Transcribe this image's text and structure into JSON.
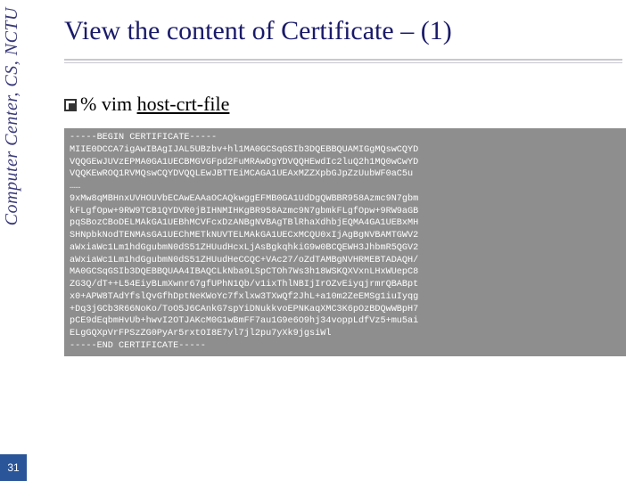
{
  "sidebar": {
    "org": "Computer Center, CS, NCTU"
  },
  "page": {
    "number": "31",
    "title": "View the content of Certificate – (1)"
  },
  "command": {
    "prefix": "% vim ",
    "filename": "host-crt-file"
  },
  "certificate": {
    "text": "-----BEGIN CERTIFICATE-----\nMIIE0DCCA7igAwIBAgIJAL5UBzbv+hl1MA0GCSqGSIb3DQEBBQUAMIGgMQswCQYD\nVQQGEwJUVzEPMA0GA1UECBMGVGFpd2FuMRAwDgYDVQQHEwdIc2luQ2h1MQ0wCwYD\nVQQKEwROQ1RVMQswCQYDVQQLEwJBTTEiMCAGA1UEAxMZZXpbGJpZzUubWF0aC5u\n……\n9xMw8qMBHnxUVHOUVbECAwEAAaOCAQkwggEFMB0GA1UdDgQWBBR958Azmc9N7gbm\nkFLgfOpw+9RW9TCB1QYDVR0jBIHNMIHKgBR958Azmc9N7gbmkFLgfOpw+9RW9aGB\npqSBozCBoDELMAkGA1UEBhMCVFcxDzANBgNVBAgTBlRhaXdhbjEQMA4GA1UEBxMH\nSHNpbkNodTENMAsGA1UEChMETkNUVTELMAkGA1UECxMCQU0xIjAgBgNVBAMTGWV2\naWxiaWc1Lm1hdGgubmN0dS51ZHUudHcxLjAsBgkqhkiG9w0BCQEWH3JhbmR5QGV2\naWxiaWc1Lm1hdGgubmN0dS51ZHUudHeCCQC+VAc27/oZdTAMBgNVHRMEBTADAQH/\nMA0GCSqGSIb3DQEBBQUAA4IBAQCLkNba9LSpCTOh7Ws3h18WSKQXVxnLHxWUepC8\nZG3Q/dT++L54EiyBLmXwnr67gfUPhN1Qb/v1ixThlNBIjIrOZvEiyqjrmrQBABpt\nx0+APW8TAdYfslQvGfhDptNeKWoYc7fxlxw3TXwQf2JhL+a10m2ZeEMSg1iuIyqg\n+Dq3jGCb3R66NoKo/ToO5J6CAnkG7spYiDNukkvoEPNKaqXMC3K6pOzBDQwWBpH7\npCE9dEqbmHvUb+hwvI2OTJAKcM0G1wBmFF7au1G9e6O9hj34voppLdfVz5+mu5ai\nELgGQXpVrFPSzZG0PyAr5rxtOI8E7yl7jl2pu7yXk9jgsiWl\n-----END CERTIFICATE-----"
  }
}
